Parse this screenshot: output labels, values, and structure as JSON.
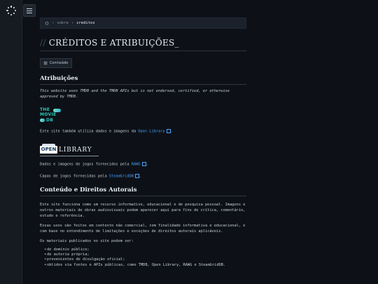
{
  "breadcrumb": {
    "home_icon": "home-icon",
    "sep": "›",
    "parent": "sobre",
    "current": "creditos"
  },
  "title": {
    "slash": "//",
    "text": "CRÉDITOS E ATRIBUIÇÕES_"
  },
  "toc": {
    "label": "Conteúdo"
  },
  "sections": {
    "attributions": {
      "heading": "Atribuições",
      "tmdb_disclaimer": "This website uses TMDB and the TMDB APIs but is not endorsed, certified, or otherwise approved by TMDB.",
      "tmdb_logo": {
        "line1": "THE",
        "line2": "MOVIE",
        "line3": "DB"
      },
      "openlibrary_pre": "Este site também utiliza dados e imagens da ",
      "openlibrary_link": "Open Library",
      "openlibrary_post": ".",
      "openlibrary_logo": {
        "open": "OPEN",
        "library": "LIBRARY"
      },
      "rawg_pre": "Dados e imagens de jogos fornecidos pela ",
      "rawg_link": "RAWG",
      "rawg_post": ".",
      "sgdb_pre": "Capas de jogos fornecidas pela ",
      "sgdb_link": "SteamGridDB",
      "sgdb_post": "."
    },
    "rights": {
      "heading": "Conteúdo e Direitos Autorais",
      "p1": "Este site funciona como um recurso informativo, educacional e de pesquisa pessoal. Imagens e outros materiais de obras audiovisuais podem aparecer aqui para fins de crítica, comentário, estudo e referência.",
      "p2": "Essas usos são feitos em contexto não comercial, com finalidade informativa e educacional, e com base no entendimento de limitações e exceções de direitos autorais aplicáveis.",
      "p3": "Os materiais publicados no site podem ser:",
      "list": [
        "de domínio público;",
        "de autoria própria;",
        "provenientes de divulgação oficial;",
        "obtidos via fontes e APIs públicas, como TMDB, Open Library, RAWG e SteamGridDB."
      ]
    }
  }
}
